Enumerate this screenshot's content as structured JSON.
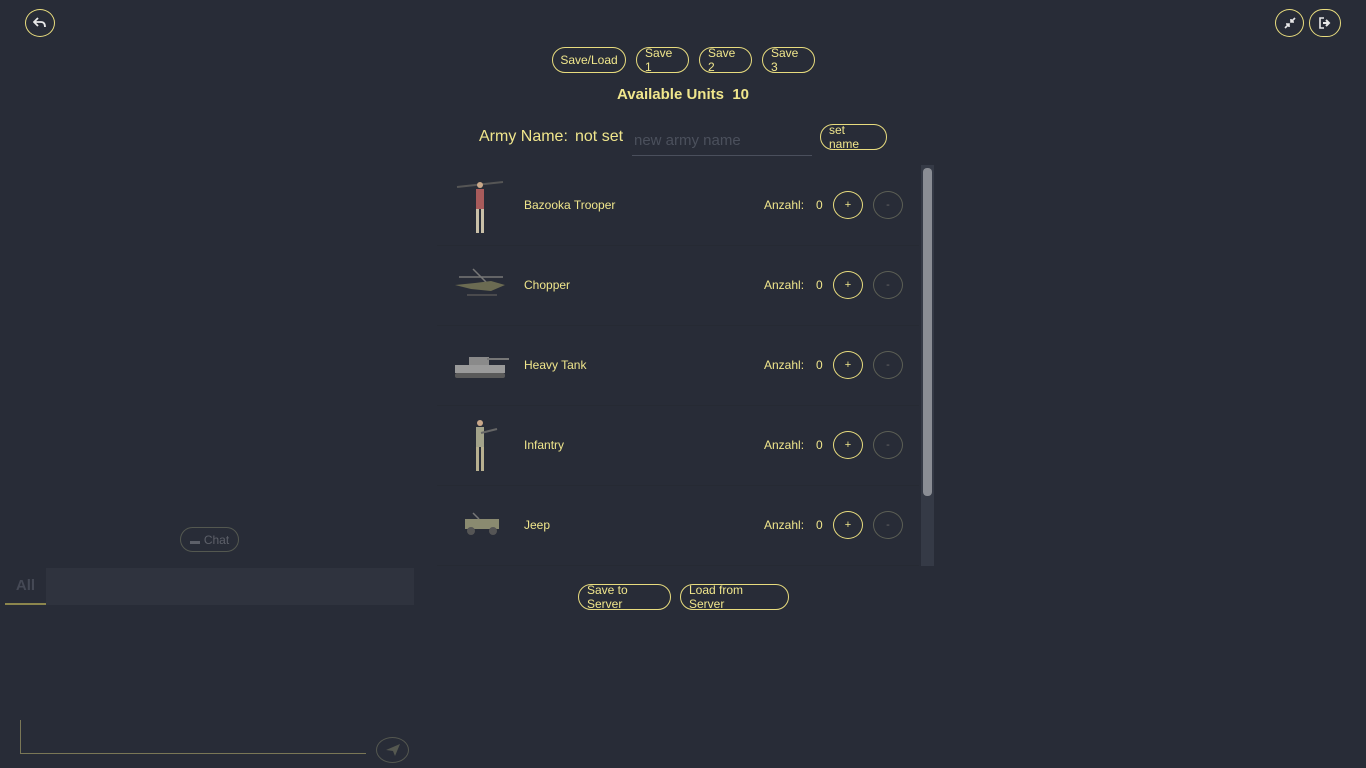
{
  "header": {
    "back_icon": "back-arrow-icon",
    "compress_icon": "compress-icon",
    "logout_icon": "logout-icon"
  },
  "save_bar": {
    "save_load": "Save/Load",
    "save1": "Save 1",
    "save2": "Save 2",
    "save3": "Save 3"
  },
  "available_units": {
    "label": "Available Units",
    "count": "10"
  },
  "army_name": {
    "label": "Army Name:",
    "value": "not set",
    "placeholder": "new army name",
    "set_button": "set name"
  },
  "units": [
    {
      "name": "Bazooka Trooper",
      "count_label": "Anzahl:",
      "count": "0",
      "plus": "+",
      "minus": "-"
    },
    {
      "name": "Chopper",
      "count_label": "Anzahl:",
      "count": "0",
      "plus": "+",
      "minus": "-"
    },
    {
      "name": "Heavy Tank",
      "count_label": "Anzahl:",
      "count": "0",
      "plus": "+",
      "minus": "-"
    },
    {
      "name": "Infantry",
      "count_label": "Anzahl:",
      "count": "0",
      "plus": "+",
      "minus": "-"
    },
    {
      "name": "Jeep",
      "count_label": "Anzahl:",
      "count": "0",
      "plus": "+",
      "minus": "-"
    }
  ],
  "server": {
    "save": "Save to Server",
    "load": "Load from Server"
  },
  "chat": {
    "toggle_label": "Chat",
    "tab_all": "All"
  },
  "colors": {
    "background": "#282c37",
    "accent": "#f0e68c",
    "border": "#e8dc7e"
  }
}
